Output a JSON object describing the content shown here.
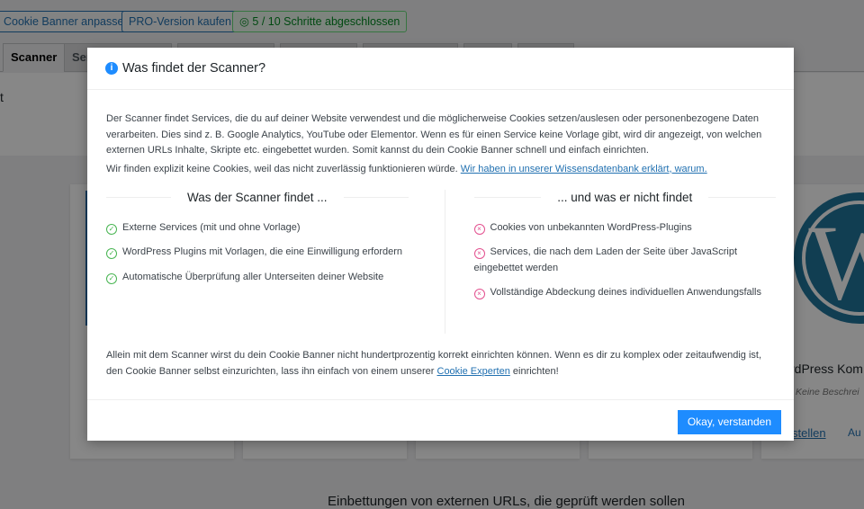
{
  "top_buttons": {
    "customize": "Cookie Banner anpassen",
    "pro": "PRO-Version kaufen",
    "progress": "5 / 10 Schritte abgeschlossen",
    "progress_icon": "check-circle-icon"
  },
  "tabs": [
    "Scanner",
    "Ser"
  ],
  "background": {
    "left_fragment": "t",
    "plugin_title": "rdPress Kom",
    "plugin_desc": "Keine Beschrei",
    "link1": "stellen",
    "link2": "Au",
    "section_heading": "Einbettungen von externen URLs, die geprüft werden sollen"
  },
  "modal": {
    "title": "Was findet der Scanner?",
    "intro": "Der Scanner findet Services, die du auf deiner Website verwendest und die möglicherweise Cookies setzen/auslesen oder personenbezogene Daten verarbeiten. Dies sind z. B. Google Analytics, YouTube oder Elementor. Wenn es für einen Service keine Vorlage gibt, wird dir angezeigt, von welchen externen URLs Inhalte, Skripte etc. eingebettet wurden. Somit kannst du dein Cookie Banner schnell und einfach einrichten.",
    "note": "Wir finden explizit keine Cookies, weil das nicht zuverlässig funktionieren würde.",
    "note_link": "Wir haben in unserer Wissensdatenbank erklärt, warum.",
    "finds_title": "Was der Scanner findet ...",
    "finds": [
      "Externe Services (mit und ohne Vorlage)",
      "WordPress Plugins mit Vorlagen, die eine Einwilligung erfordern",
      "Automatische Überprüfung aller Unterseiten deiner Website"
    ],
    "not_title": "... und was er nicht findet",
    "not_finds": [
      "Cookies von unbekannten WordPress-Plugins",
      "Services, die nach dem Laden der Seite über JavaScript eingebettet werden",
      "Vollständige Abdeckung deines individuellen Anwendungsfalls"
    ],
    "outro_before": "Allein mit dem Scanner wirst du dein Cookie Banner nicht hundertprozentig korrekt einrichten können. Wenn es dir zu komplex oder zeitaufwendig ist, den Cookie Banner selbst einzurichten, lass ihn einfach von einem unserer",
    "outro_link": "Cookie Experten",
    "outro_after": "einrichten!",
    "ok_button": "Okay, verstanden"
  },
  "colors": {
    "accent": "#1e8cff",
    "check": "#46b450",
    "cross": "#e3508f",
    "wp_blue": "#21759b"
  }
}
